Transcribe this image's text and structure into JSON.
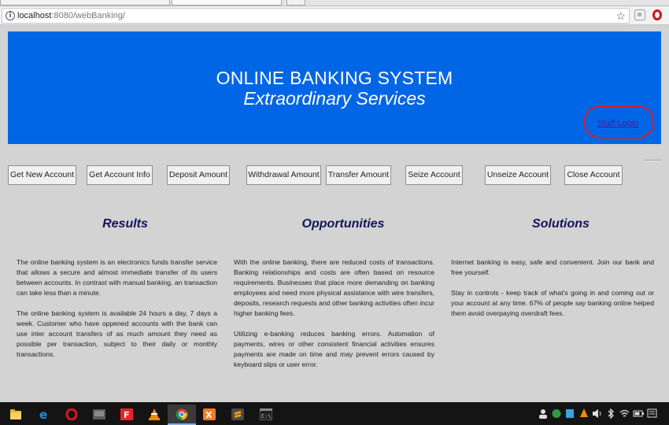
{
  "browser": {
    "url_host": "localhost",
    "url_rest": ":8080/webBanking/"
  },
  "header": {
    "title": "ONLINE BANKING SYSTEM",
    "subtitle": "Extraordinary Services",
    "staff_login": "Staff Login"
  },
  "nav": [
    {
      "label": "Get New Account"
    },
    {
      "label": "Get Account Info"
    },
    {
      "label": "Deposit Amount"
    },
    {
      "label": "Withdrawal Amount"
    },
    {
      "label": "Transfer Amount"
    },
    {
      "label": "Seize Account"
    },
    {
      "label": "Unseize Account"
    },
    {
      "label": "Close Account"
    }
  ],
  "columns": [
    {
      "title": "Results",
      "paragraphs": [
        "The online banking system is an electronics funds transfer service that allows a secure and almost immediate transfer of its users between accounts. In contrast with manual banking, an transaction can take less than a minute.",
        "The online banking system is available 24 hours a day, 7 days a week. Customer who have oppened accounts with the bank can use inter account transfers of as much amount they need as possible per transaction, subject to their daily or monthly transactions."
      ]
    },
    {
      "title": "Opportunities",
      "paragraphs": [
        "With the online banking, there are reduced costs of transactions. Banking relationships and costs are often based on resource requirements. Businesses that place more demanding on banking employees and need more physical assistance with wire transfers, deposits, research requests and other banking activities often incur higher banking fees.",
        "Utilizing e-banking reduces banking errors. Automation of payments, wires or other consistent financial activities ensures payments are made on time and may prevent errors caused by keyboard slips or user error."
      ]
    },
    {
      "title": "Solutions",
      "paragraphs": [
        "Internet banking is easy, safe and convenient. Join our bank and free yourself.",
        "Stay in controls - keep track of what's going in and coming out or your account at any time. 67% of people say banking online helped them avoid overpaying overdraft fees."
      ]
    }
  ],
  "taskbar": {
    "apps": [
      {
        "icon": "file-explorer-icon"
      },
      {
        "icon": "edge-icon"
      },
      {
        "icon": "opera-icon"
      },
      {
        "icon": "media-app-icon"
      },
      {
        "icon": "foxit-reader-icon"
      },
      {
        "icon": "vlc-icon"
      },
      {
        "icon": "chrome-icon"
      },
      {
        "icon": "xampp-icon"
      },
      {
        "icon": "sublime-text-icon"
      },
      {
        "icon": "command-prompt-icon"
      }
    ],
    "colors": {
      "edge": "#1e90e8",
      "opera": "#e0141e",
      "foxit": "#e8252b",
      "vlc": "#f18a00",
      "xampp": "#fb7a24",
      "sublime": "#ff9800"
    }
  }
}
